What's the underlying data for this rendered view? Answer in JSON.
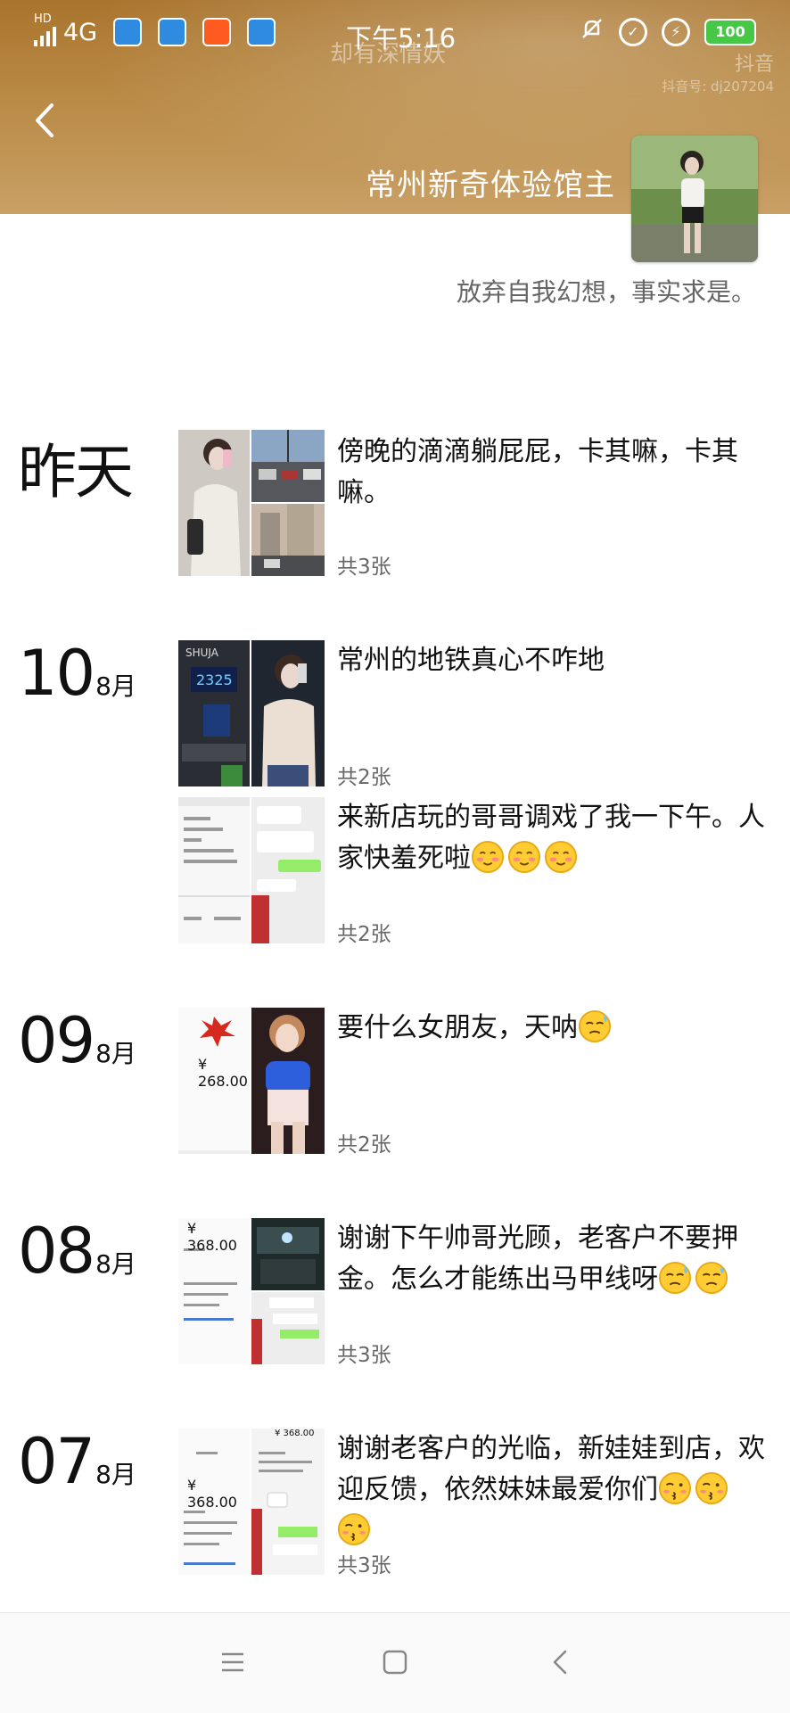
{
  "status_bar": {
    "hd": "HD",
    "network": "4G",
    "time": "下午5:16",
    "battery": "100",
    "icons": [
      "signal-icon",
      "app-notification-icon",
      "app-notification-icon",
      "app-notification-icon",
      "app-notification-icon",
      "mute-icon",
      "alarm-icon",
      "charging-icon",
      "battery-icon"
    ]
  },
  "watermark": {
    "brand": "抖音",
    "id": "抖音号: dj207204",
    "overlay": "却有深情妖"
  },
  "profile": {
    "name": "常州新奇体验馆主",
    "motto": "放弃自我幻想，事实求是。"
  },
  "posts": [
    {
      "day_label": "昨天",
      "month": "",
      "text": "傍晚的滴滴躺屁屁，卡其嘛，卡其嘛。",
      "count": "共3张",
      "photos": 3
    },
    {
      "day_label": "10",
      "month": "8月",
      "text": "常州的地铁真心不咋地",
      "count": "共2张",
      "photos": 2
    },
    {
      "day_label": "",
      "month": "",
      "text": "来新店玩的哥哥调戏了我一下午。人家快羞死啦",
      "emojis": [
        "blush-emoji",
        "blush-emoji",
        "blush-emoji"
      ],
      "count": "共2张",
      "photos": 2
    },
    {
      "day_label": "09",
      "month": "8月",
      "text": "要什么女朋友，天呐",
      "emojis": [
        "sweat-relief-emoji"
      ],
      "count": "共2张",
      "photos": 2,
      "price": "¥ 268.00"
    },
    {
      "day_label": "08",
      "month": "8月",
      "text": "谢谢下午帅哥光顾，老客户不要押金。怎么才能练出马甲线呀",
      "emojis": [
        "sweat-relief-emoji",
        "sweat-relief-emoji"
      ],
      "count": "共3张",
      "photos": 3,
      "price": "¥ 368.00"
    },
    {
      "day_label": "07",
      "month": "8月",
      "text": "谢谢老客户的光临，新娃娃到店，欢迎反馈，依然妹妹最爱你们",
      "emojis": [
        "kiss-emoji",
        "kiss-emoji",
        "kiss-emoji"
      ],
      "count": "共3张",
      "photos": 3,
      "price": "¥ 368.00",
      "price2": "¥ 368.00"
    }
  ],
  "thumb_text": {
    "metro_display": "2325",
    "metro_brand": "SHUJA"
  },
  "nav": {
    "buttons": [
      "menu-icon",
      "home-icon",
      "back-icon"
    ]
  },
  "colors": {
    "header_top": "#a9742d",
    "header_bottom": "#c9a066",
    "battery_green": "#46c846",
    "muted_text": "#666666"
  }
}
